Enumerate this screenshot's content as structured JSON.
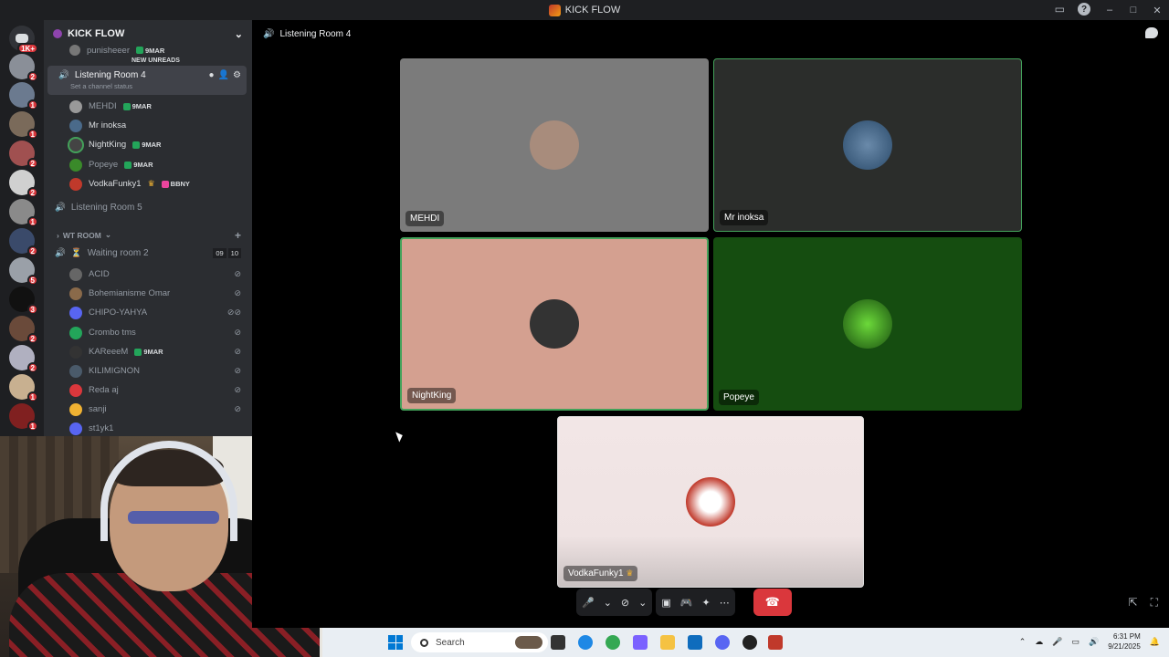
{
  "window": {
    "title": "KICK FLOW"
  },
  "guilds": {
    "home_badge": "1K+",
    "badges": [
      "2",
      "1",
      "1",
      "2",
      "2",
      "1",
      "2",
      "5",
      "3",
      "2",
      "2",
      "1",
      "1"
    ]
  },
  "server": {
    "name": "KICK FLOW"
  },
  "sidebar": {
    "partial_member": {
      "name": "punisheeer",
      "tag": "9MAR"
    },
    "new_unreads": "NEW UNREADS",
    "active_channel": {
      "name": "Listening Room 4",
      "status_placeholder": "Set a channel status"
    },
    "members": [
      {
        "name": "MEHDI",
        "tag": "9MAR",
        "bright": false
      },
      {
        "name": "Mr inoksa",
        "tag": "",
        "bright": true
      },
      {
        "name": "NightKing",
        "tag": "9MAR",
        "bright": true
      },
      {
        "name": "Popeye",
        "tag": "9MAR",
        "bright": false
      },
      {
        "name": "VodkaFunky1",
        "tag": "BBNY",
        "bright": true
      }
    ],
    "channel_room5": "Listening Room 5",
    "category": "WT ROOM",
    "waiting_room": {
      "name": "Waiting room 2",
      "count_a": "09",
      "count_b": "10"
    },
    "waiting_members": [
      {
        "name": "ACID"
      },
      {
        "name": "Bohemianisme Omar"
      },
      {
        "name": "CHIPO-YAHYA"
      },
      {
        "name": "Crombo tms"
      },
      {
        "name": "KAReeeM",
        "tag": "9MAR"
      },
      {
        "name": "KILIMIGNON"
      },
      {
        "name": "Reda aj"
      },
      {
        "name": "sanji"
      },
      {
        "name": "st1yk1"
      }
    ]
  },
  "call": {
    "channel_title": "Listening Room 4",
    "tiles": [
      {
        "label": "MEHDI"
      },
      {
        "label": "Mr inoksa"
      },
      {
        "label": "NightKing"
      },
      {
        "label": "Popeye"
      },
      {
        "label": "VodkaFunky1"
      }
    ]
  },
  "taskbar": {
    "search_placeholder": "Search",
    "time": "6:31 PM",
    "date": "9/21/2025"
  },
  "colors": {
    "accent": "#5865f2",
    "speaking": "#43a25a",
    "hangup": "#da373c",
    "bg": "#2b2d31"
  }
}
